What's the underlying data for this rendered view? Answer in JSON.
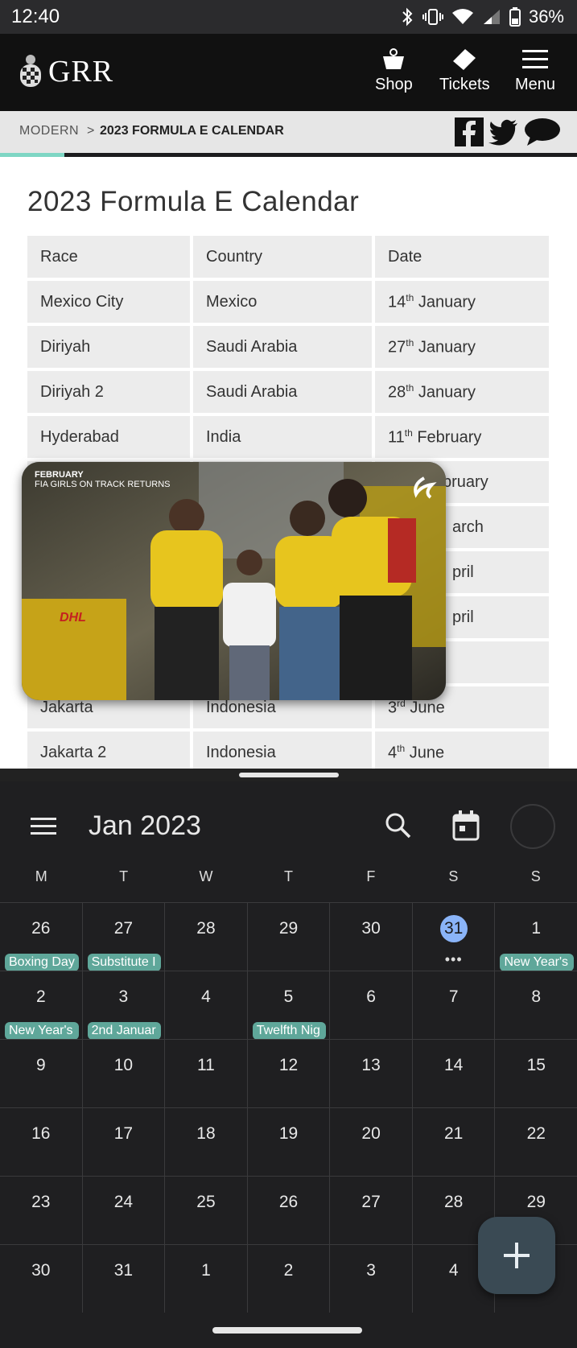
{
  "status_bar": {
    "time": "12:40",
    "battery": "36%"
  },
  "site": {
    "logo": "GRR",
    "nav": {
      "shop": "Shop",
      "tickets": "Tickets",
      "menu": "Menu"
    },
    "breadcrumb": {
      "parent": "MODERN",
      "separator": ">",
      "current": "2023 FORMULA E CALENDAR"
    }
  },
  "article": {
    "title": "2023 Formula E Calendar",
    "table": {
      "headers": [
        "Race",
        "Country",
        "Date"
      ],
      "rows": [
        {
          "race": "Mexico City",
          "country": "Mexico",
          "day": "14",
          "suffix": "th",
          "month": "January"
        },
        {
          "race": "Diriyah",
          "country": "Saudi Arabia",
          "day": "27",
          "suffix": "th",
          "month": "January"
        },
        {
          "race": "Diriyah 2",
          "country": "Saudi Arabia",
          "day": "28",
          "suffix": "th",
          "month": "January"
        },
        {
          "race": "Hyderabad",
          "country": "India",
          "day": "11",
          "suffix": "th",
          "month": "February"
        },
        {
          "race": "",
          "country": "",
          "day": "",
          "suffix": "",
          "month": "",
          "partial": "bruary"
        },
        {
          "race": "",
          "country": "",
          "day": "",
          "suffix": "",
          "month": "",
          "partial": "arch"
        },
        {
          "race": "",
          "country": "",
          "day": "",
          "suffix": "",
          "month": "",
          "partial": "pril"
        },
        {
          "race": "",
          "country": "",
          "day": "",
          "suffix": "",
          "month": "",
          "partial": "pril"
        },
        {
          "race": "",
          "country": "",
          "day": "",
          "suffix": "",
          "month": "",
          "partial": ""
        },
        {
          "race": "Jakarta",
          "country": "Indonesia",
          "day": "3",
          "suffix": "rd",
          "month": "June"
        },
        {
          "race": "Jakarta 2",
          "country": "Indonesia",
          "day": "4",
          "suffix": "th",
          "month": "June"
        }
      ]
    },
    "video": {
      "month": "FEBRUARY",
      "caption": "FIA GIRLS ON TRACK RETURNS"
    }
  },
  "calendar": {
    "title": "Jan 2023",
    "weekdays": [
      "M",
      "T",
      "W",
      "T",
      "F",
      "S",
      "S"
    ],
    "weeks": [
      [
        {
          "d": "26",
          "ev": "Boxing Day"
        },
        {
          "d": "27",
          "ev": "Substitute I"
        },
        {
          "d": "28"
        },
        {
          "d": "29"
        },
        {
          "d": "30"
        },
        {
          "d": "31",
          "today": true,
          "more": "•••"
        },
        {
          "d": "1",
          "ev": "New Year's"
        }
      ],
      [
        {
          "d": "2",
          "ev": "New Year's"
        },
        {
          "d": "3",
          "ev": "2nd Januar"
        },
        {
          "d": "4"
        },
        {
          "d": "5",
          "ev": "Twelfth Nig"
        },
        {
          "d": "6"
        },
        {
          "d": "7"
        },
        {
          "d": "8"
        }
      ],
      [
        {
          "d": "9"
        },
        {
          "d": "10"
        },
        {
          "d": "11"
        },
        {
          "d": "12"
        },
        {
          "d": "13"
        },
        {
          "d": "14"
        },
        {
          "d": "15"
        }
      ],
      [
        {
          "d": "16"
        },
        {
          "d": "17"
        },
        {
          "d": "18"
        },
        {
          "d": "19"
        },
        {
          "d": "20"
        },
        {
          "d": "21"
        },
        {
          "d": "22"
        }
      ],
      [
        {
          "d": "23"
        },
        {
          "d": "24"
        },
        {
          "d": "25"
        },
        {
          "d": "26"
        },
        {
          "d": "27"
        },
        {
          "d": "28"
        },
        {
          "d": "29"
        }
      ],
      [
        {
          "d": "30"
        },
        {
          "d": "31"
        },
        {
          "d": "1"
        },
        {
          "d": "2"
        },
        {
          "d": "3"
        },
        {
          "d": "4"
        },
        {
          "d": ""
        }
      ]
    ],
    "colors": {
      "event": "#5fa79a",
      "today": "#8ab4f8"
    }
  }
}
